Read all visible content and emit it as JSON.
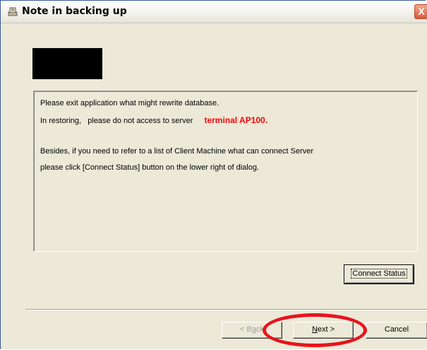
{
  "window": {
    "title": "Note in backing up",
    "close_symbol": "X",
    "title_icon": "app-icon"
  },
  "message": {
    "line1": "Please exit application what might rewrite database.",
    "line2_prefix": "In restoring,   please do not access to server",
    "line2_highlight": "terminal AP100.",
    "line3": "Besides, if you need to refer to a list of Client Machine what can connect Server",
    "line4": "please click [Connect Status] button on the lower right of dialog."
  },
  "buttons": {
    "connect_status": "Connect Status",
    "back_prefix": "< B",
    "back_underlined": "a",
    "back_suffix": "ck",
    "next_underlined": "N",
    "next_suffix": "ext >",
    "cancel": "Cancel"
  },
  "colors": {
    "highlight_text": "#ff0000",
    "annotation_ellipse": "#e8131c"
  }
}
